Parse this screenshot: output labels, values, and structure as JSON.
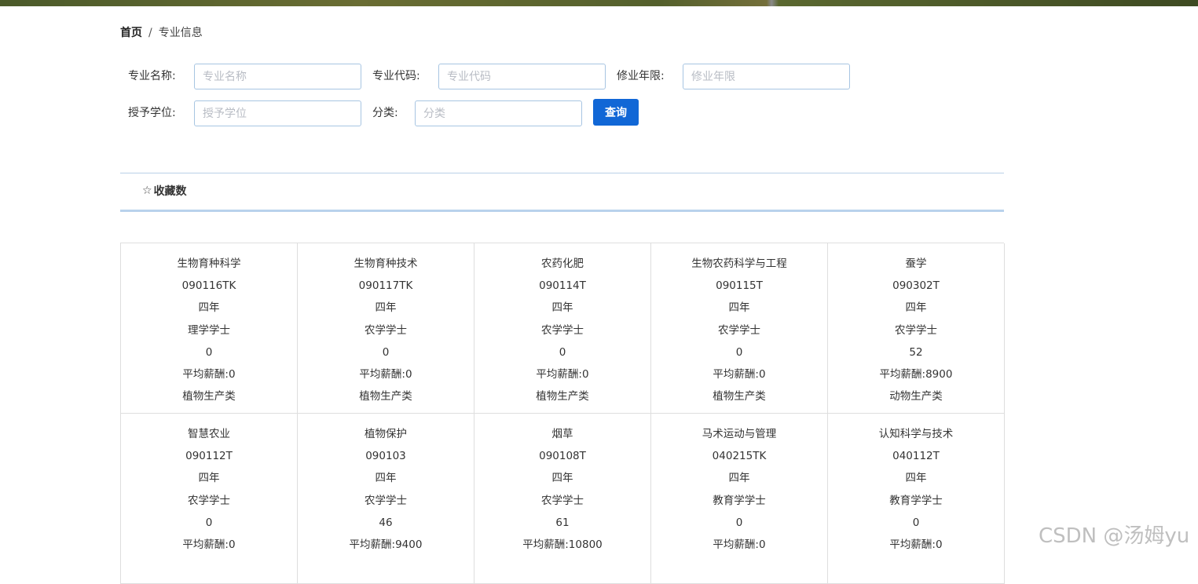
{
  "breadcrumb": {
    "home": "首页",
    "separator": "/",
    "current": "专业信息"
  },
  "search": {
    "major_name_label": "专业名称:",
    "major_name_placeholder": "专业名称",
    "major_code_label": "专业代码:",
    "major_code_placeholder": "专业代码",
    "duration_label": "修业年限:",
    "duration_placeholder": "修业年限",
    "degree_label": "授予学位:",
    "degree_placeholder": "授予学位",
    "category_label": "分类:",
    "category_placeholder": "分类",
    "query_button": "查询"
  },
  "sort": {
    "star_icon": "☆",
    "favorites_label": "收藏数"
  },
  "majors": [
    {
      "name": "生物育种科学",
      "code": "090116TK",
      "duration": "四年",
      "degree": "理学学士",
      "favorites": "0",
      "salary": "平均薪酬:0",
      "category": "植物生产类"
    },
    {
      "name": "生物育种技术",
      "code": "090117TK",
      "duration": "四年",
      "degree": "农学学士",
      "favorites": "0",
      "salary": "平均薪酬:0",
      "category": "植物生产类"
    },
    {
      "name": "农药化肥",
      "code": "090114T",
      "duration": "四年",
      "degree": "农学学士",
      "favorites": "0",
      "salary": "平均薪酬:0",
      "category": "植物生产类"
    },
    {
      "name": "生物农药科学与工程",
      "code": "090115T",
      "duration": "四年",
      "degree": "农学学士",
      "favorites": "0",
      "salary": "平均薪酬:0",
      "category": "植物生产类"
    },
    {
      "name": "蚕学",
      "code": "090302T",
      "duration": "四年",
      "degree": "农学学士",
      "favorites": "52",
      "salary": "平均薪酬:8900",
      "category": "动物生产类"
    },
    {
      "name": "智慧农业",
      "code": "090112T",
      "duration": "四年",
      "degree": "农学学士",
      "favorites": "0",
      "salary": "平均薪酬:0",
      "category": ""
    },
    {
      "name": "植物保护",
      "code": "090103",
      "duration": "四年",
      "degree": "农学学士",
      "favorites": "46",
      "salary": "平均薪酬:9400",
      "category": ""
    },
    {
      "name": "烟草",
      "code": "090108T",
      "duration": "四年",
      "degree": "农学学士",
      "favorites": "61",
      "salary": "平均薪酬:10800",
      "category": ""
    },
    {
      "name": "马术运动与管理",
      "code": "040215TK",
      "duration": "四年",
      "degree": "教育学学士",
      "favorites": "0",
      "salary": "平均薪酬:0",
      "category": ""
    },
    {
      "name": "认知科学与技术",
      "code": "040112T",
      "duration": "四年",
      "degree": "教育学学士",
      "favorites": "0",
      "salary": "平均薪酬:0",
      "category": ""
    }
  ],
  "watermark": "CSDN @汤姆yu"
}
